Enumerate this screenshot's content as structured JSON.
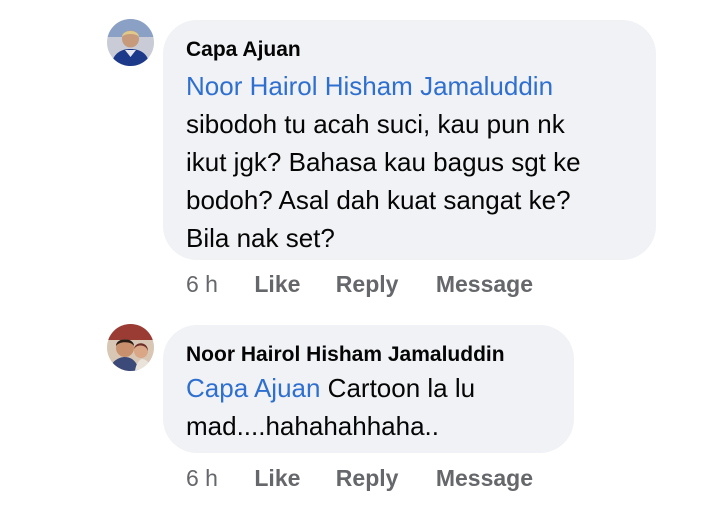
{
  "comments": [
    {
      "author": "Capa Ajuan",
      "mention": "Noor Hairol Hisham Jamaluddin",
      "lines": [
        "sibodoh tu acah suci, kau pun nk",
        "ikut jgk? Bahasa kau bagus sgt ke",
        "bodoh? Asal dah kuat sangat ke?",
        "Bila nak set?"
      ],
      "time": "6 h",
      "actions": {
        "like": "Like",
        "reply": "Reply",
        "message": "Message"
      }
    },
    {
      "author": "Noor Hairol Hisham Jamaluddin",
      "mention": "Capa Ajuan",
      "text_after_mention": " Cartoon la lu",
      "lines": [
        "mad....hahahahhaha.."
      ],
      "time": "6 h",
      "actions": {
        "like": "Like",
        "reply": "Reply",
        "message": "Message"
      }
    }
  ],
  "colors": {
    "bubble": "#f0f2f5",
    "mention": "#2e6fd0",
    "meta": "#65676b",
    "text": "#050505"
  }
}
